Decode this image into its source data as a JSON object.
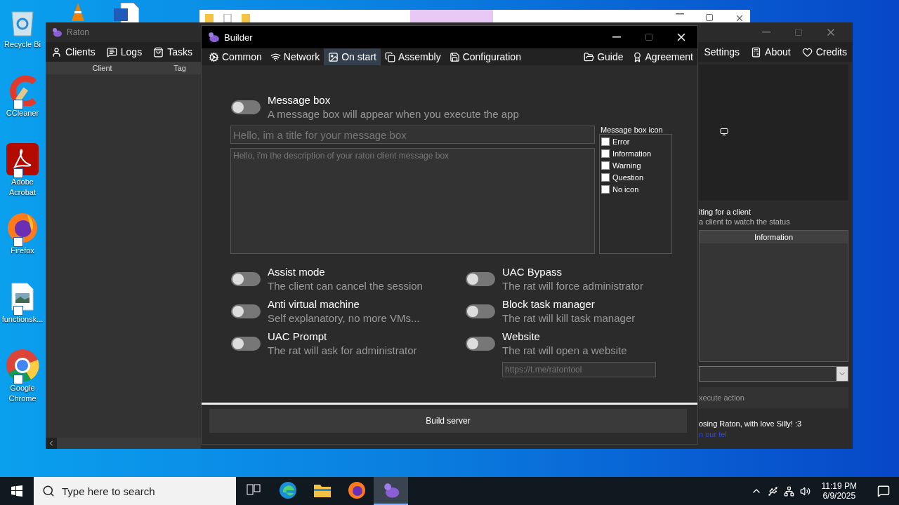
{
  "desktop_icons": [
    {
      "kind": "recycle",
      "label": "Recycle Bi"
    },
    {
      "kind": "ccleaner",
      "label": "CCleaner"
    },
    {
      "kind": "acrobat",
      "label": "Adobe Acrobat"
    },
    {
      "kind": "firefox",
      "label": "Firefox"
    },
    {
      "kind": "image-file",
      "label": "functionsk..."
    },
    {
      "kind": "chrome",
      "label": "Google Chrome"
    }
  ],
  "hidden_icons": [
    {
      "kind": "cone"
    },
    {
      "kind": "document"
    }
  ],
  "raton": {
    "title": "Raton",
    "nav_left": [
      {
        "kind": "user",
        "label": "Clients"
      },
      {
        "kind": "chat",
        "label": "Logs"
      },
      {
        "kind": "bag",
        "label": "Tasks"
      }
    ],
    "nav_right": [
      {
        "label": "Settings"
      },
      {
        "kind": "calc",
        "label": "About"
      },
      {
        "kind": "heart",
        "label": "Credits"
      }
    ],
    "columns": [
      "Client",
      "Tag"
    ],
    "status_title": "iting for a client",
    "status_text": "a client to watch the status",
    "info_header": "Information",
    "execute_button": "xecute action",
    "footer": "osing Raton, with love Silly! :3",
    "footer_link": "n our tel"
  },
  "builder": {
    "title": "Builder",
    "tabs": [
      {
        "kind": "gear",
        "label": "Common",
        "selected": false
      },
      {
        "kind": "wifi",
        "label": "Network",
        "selected": false
      },
      {
        "kind": "image",
        "label": "On start",
        "selected": true
      },
      {
        "kind": "copy",
        "label": "Assembly",
        "selected": false
      },
      {
        "kind": "save",
        "label": "Configuration",
        "selected": false
      }
    ],
    "links": [
      {
        "kind": "folder",
        "label": "Guide"
      },
      {
        "kind": "award",
        "label": "Agreement"
      }
    ],
    "message_box": {
      "title": "Message box",
      "description": "A message box will appear when you execute the app",
      "on": false,
      "title_placeholder": "Hello, im a title for your message box",
      "text_placeholder": "Hello, i'm the description of your raton client message box",
      "icon_group": "Message box icon",
      "icons": [
        {
          "label": "Error",
          "checked": false
        },
        {
          "label": "Information",
          "checked": false
        },
        {
          "label": "Warning",
          "checked": false
        },
        {
          "label": "Question",
          "checked": false
        },
        {
          "label": "No icon",
          "checked": false
        }
      ]
    },
    "options": [
      {
        "title": "Assist mode",
        "description": "The client can cancel the session",
        "on": false
      },
      {
        "title": "UAC Bypass",
        "description": "The rat will force administrator",
        "on": false
      },
      {
        "title": "Anti virtual machine",
        "description": "Self explanatory, no more VMs...",
        "on": false
      },
      {
        "title": "Block task manager",
        "description": "The rat will kill task manager",
        "on": false
      },
      {
        "title": "UAC Prompt",
        "description": "The rat will ask for administrator",
        "on": false
      },
      {
        "title": "Website",
        "description": "The rat will open a website",
        "on": false,
        "placeholder": "https://t.me/ratontool"
      }
    ],
    "build_button": "Build server"
  },
  "taskbar": {
    "search_placeholder": "Type here to search",
    "apps": [
      {
        "kind": "taskview",
        "selected": false
      },
      {
        "kind": "edge",
        "selected": false
      },
      {
        "kind": "explorer",
        "selected": false
      },
      {
        "kind": "firefox",
        "selected": false
      },
      {
        "kind": "raton",
        "selected": true
      }
    ],
    "time": "11:19 PM",
    "date": "6/9/2025"
  }
}
